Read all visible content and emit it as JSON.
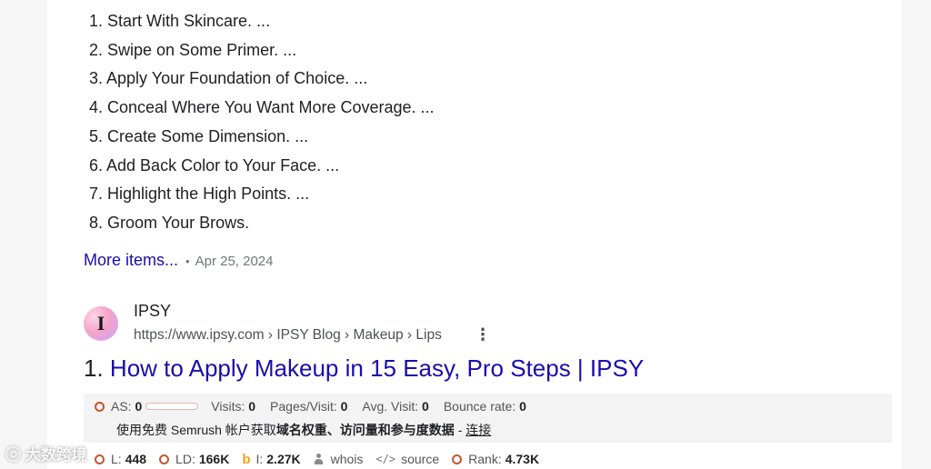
{
  "steps": [
    "1. Start With Skincare. ...",
    "2. Swipe on Some Primer. ...",
    "3. Apply Your Foundation of Choice. ...",
    "4. Conceal Where You Want More Coverage. ...",
    "5. Create Some Dimension. ...",
    "6. Add Back Color to Your Face. ...",
    "7. Highlight the High Points. ...",
    "8. Groom Your Brows."
  ],
  "more_items_label": "More items...",
  "date": "Apr 25, 2024",
  "result": {
    "favicon_letter": "I",
    "site_name": "IPSY",
    "breadcrumb": "https://www.ipsy.com › IPSY Blog › Makeup › Lips",
    "menu_icon": "more-vertical-icon",
    "number": "1.",
    "title": "How to Apply Makeup in 15 Easy, Pro Steps | IPSY"
  },
  "semrush": {
    "as_label": "AS:",
    "as_value": "0",
    "visits_label": "Visits:",
    "visits_value": "0",
    "pages_label": "Pages/Visit:",
    "pages_value": "0",
    "avg_label": "Avg. Visit:",
    "avg_value": "0",
    "bounce_label": "Bounce rate:",
    "bounce_value": "0",
    "promo_prefix": "使用免费 Semrush 帐户获取",
    "promo_bold": "域名权重、访问量和参与度数据",
    "promo_sep": " - ",
    "promo_link": "连接",
    "l_label": "L:",
    "l_value": "448",
    "ld_label": "LD:",
    "ld_value": "166K",
    "i_label": "I:",
    "i_value": "2.27K",
    "whois_label": "whois",
    "source_label": "source",
    "rank_label": "Rank:",
    "rank_value": "4.73K"
  },
  "watermark": "大数跨境",
  "colors": {
    "link": "#1a0dab",
    "ring": "#c8552f",
    "bing": "#f0a21a"
  }
}
